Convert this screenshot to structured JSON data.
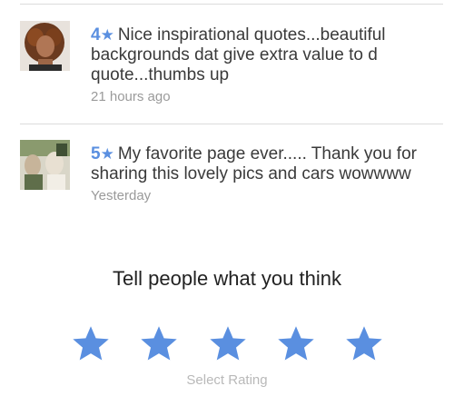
{
  "reviews": [
    {
      "stars": "4",
      "text": "Nice inspirational quotes...beautiful backgrounds dat give extra value to d quote...thumbs up",
      "time": "21 hours ago"
    },
    {
      "stars": "5",
      "text": "My favorite page ever..... Thank you for sharing this lovely pics and cars wowwww",
      "time": "Yesterday"
    }
  ],
  "rating": {
    "prompt": "Tell people what you think",
    "hint": "Select Rating",
    "max_stars": 5,
    "selected": 0
  },
  "colors": {
    "accent": "#5a8fe0",
    "muted_text": "#9a9a9a"
  }
}
